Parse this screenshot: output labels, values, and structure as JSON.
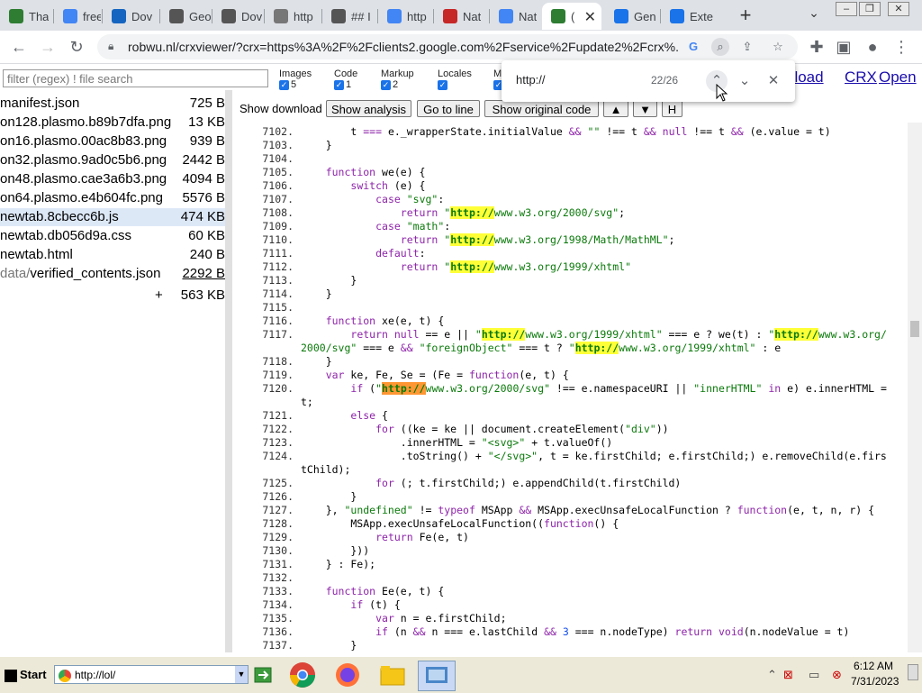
{
  "tabs": [
    {
      "title": "Tha",
      "icon": "plasmo-icon",
      "color": "#2e7d32"
    },
    {
      "title": "free",
      "icon": "google-icon",
      "color": "#4285f4"
    },
    {
      "title": "Dov",
      "icon": "dov-icon",
      "color": "#1565c0"
    },
    {
      "title": "Geo",
      "icon": "geo-icon",
      "color": "#555555"
    },
    {
      "title": "Dov",
      "icon": "globe-icon",
      "color": "#555555"
    },
    {
      "title": "http",
      "icon": "page-icon",
      "color": "#777777"
    },
    {
      "title": "## I",
      "icon": "search-globe-icon",
      "color": "#555555"
    },
    {
      "title": "http",
      "icon": "cloud-icon",
      "color": "#4285f4"
    },
    {
      "title": "Nat",
      "icon": "nat-icon",
      "color": "#c62828"
    },
    {
      "title": "Nat",
      "icon": "cloud-icon",
      "color": "#4285f4"
    },
    {
      "title": "(",
      "icon": "crx-icon",
      "color": "#2e7d32",
      "active": true
    },
    {
      "title": "Gen",
      "icon": "search-icon",
      "color": "#1a73e8"
    },
    {
      "title": "Exte",
      "icon": "puzzle-icon",
      "color": "#1a73e8"
    }
  ],
  "address": {
    "url": "robwu.nl/crxviewer/?crx=https%3A%2F%2Fclients2.google.com%2Fservice%2Fupdate2%2Fcrx%..."
  },
  "filter": {
    "placeholder": "filter (regex) ! file search"
  },
  "file_types": [
    {
      "label": "Images",
      "count": "5"
    },
    {
      "label": "Code",
      "count": "1"
    },
    {
      "label": "Markup",
      "count": "2"
    },
    {
      "label": "Locales",
      "count": ""
    },
    {
      "label": "M",
      "count": ""
    }
  ],
  "files": [
    {
      "name": "manifest.json",
      "size": "725 B"
    },
    {
      "name": "on128.plasmo.b89b7dfa.png",
      "size": "13 KB"
    },
    {
      "name": "on16.plasmo.00ac8b83.png",
      "size": "939 B"
    },
    {
      "name": "on32.plasmo.9ad0c5b6.png",
      "size": "2442 B"
    },
    {
      "name": "on48.plasmo.cae3a6b3.png",
      "size": "4094 B"
    },
    {
      "name": "on64.plasmo.e4b604fc.png",
      "size": "5576 B"
    },
    {
      "name": "newtab.8cbecc6b.js",
      "size": "474 KB",
      "selected": true
    },
    {
      "name": "newtab.db056d9a.css",
      "size": "60 KB"
    },
    {
      "name": "newtab.html",
      "size": "240 B"
    },
    {
      "name_dim": "data/",
      "name": "verified_contents.json",
      "size": "2292 B"
    }
  ],
  "total": {
    "plus": "+",
    "size": "563 KB"
  },
  "buttons": {
    "show_download": "Show download",
    "show_analysis": "Show analysis",
    "go_to_line": "Go to line",
    "show_original": "Show original code",
    "up": "▲",
    "down": "▼",
    "h": "H"
  },
  "top_links": {
    "download": "nload",
    "crx": "CRX",
    "open": "Open"
  },
  "find": {
    "query": "http://",
    "count": "22/26"
  },
  "code_lines": [
    {
      "n": "7102.",
      "html": "        t <span class=\"kw\">===</span> e._wrapperState.initialValue <span class=\"kw\">&amp;&amp;</span> <span class=\"str\">\"\"</span> !== t <span class=\"kw\">&amp;&amp;</span> <span class=\"kw\">null</span> !== t <span class=\"kw\">&amp;&amp;</span> (e.value = t)"
    },
    {
      "n": "7103.",
      "html": "    }"
    },
    {
      "n": "7104.",
      "html": ""
    },
    {
      "n": "7105.",
      "html": "    <span class=\"kw\">function</span> we(e) {"
    },
    {
      "n": "7106.",
      "html": "        <span class=\"kw\">switch</span> (e) {"
    },
    {
      "n": "7107.",
      "html": "            <span class=\"kw\">case</span> <span class=\"str\">\"svg\"</span>:"
    },
    {
      "n": "7108.",
      "html": "                <span class=\"kw\">return</span> <span class=\"str\">\"<span class=\"hl\">http://</span>www.w3.org/2000/svg\"</span>;"
    },
    {
      "n": "7109.",
      "html": "            <span class=\"kw\">case</span> <span class=\"str\">\"math\"</span>:"
    },
    {
      "n": "7110.",
      "html": "                <span class=\"kw\">return</span> <span class=\"str\">\"<span class=\"hl\">http://</span>www.w3.org/1998/Math/MathML\"</span>;"
    },
    {
      "n": "7111.",
      "html": "            <span class=\"kw\">default</span>:"
    },
    {
      "n": "7112.",
      "html": "                <span class=\"kw\">return</span> <span class=\"str\">\"<span class=\"hl\">http://</span>www.w3.org/1999/xhtml\"</span>"
    },
    {
      "n": "7113.",
      "html": "        }"
    },
    {
      "n": "7114.",
      "html": "    }"
    },
    {
      "n": "7115.",
      "html": ""
    },
    {
      "n": "7116.",
      "html": "    <span class=\"kw\">function</span> xe(e, t) {"
    },
    {
      "n": "7117.",
      "html": "        <span class=\"kw\">return</span> <span class=\"kw\">null</span> == e || <span class=\"str\">\"<span class=\"hl\">http://</span>www.w3.org/1999/xhtml\"</span> === e ? we(t) : <span class=\"str\">\"<span class=\"hl\">http://</span>www.w3.org/</span>"
    },
    {
      "n": "",
      "html": "<span class=\"str\">2000/svg\"</span> === e <span class=\"kw\">&amp;&amp;</span> <span class=\"str\">\"foreignObject\"</span> === t ? <span class=\"str\">\"<span class=\"hl\">http://</span>www.w3.org/1999/xhtml\"</span> : e"
    },
    {
      "n": "7118.",
      "html": "    }"
    },
    {
      "n": "7119.",
      "html": "    <span class=\"kw\">var</span> ke, Fe, Se = (Fe = <span class=\"kw\">function</span>(e, t) {"
    },
    {
      "n": "7120.",
      "html": "        <span class=\"kw\">if</span> (<span class=\"str\">\"<span class=\"hlc\">http://</span>www.w3.org/2000/svg\"</span> !== e.namespaceURI || <span class=\"str\">\"innerHTML\"</span> <span class=\"kw\">in</span> e) e.innerHTML ="
    },
    {
      "n": "",
      "html": "t;"
    },
    {
      "n": "7121.",
      "html": "        <span class=\"kw\">else</span> {"
    },
    {
      "n": "7122.",
      "html": "            <span class=\"kw\">for</span> ((ke = ke || document.createElement(<span class=\"str\">\"div\"</span>))"
    },
    {
      "n": "7123.",
      "html": "                .innerHTML = <span class=\"str\">\"&lt;svg&gt;\"</span> + t.valueOf()"
    },
    {
      "n": "7124.",
      "html": "                .toString() + <span class=\"str\">\"&lt;/svg&gt;\"</span>, t = ke.firstChild; e.firstChild;) e.removeChild(e.firs"
    },
    {
      "n": "",
      "html": "tChild);"
    },
    {
      "n": "7125.",
      "html": "            <span class=\"kw\">for</span> (; t.firstChild;) e.appendChild(t.firstChild)"
    },
    {
      "n": "7126.",
      "html": "        }"
    },
    {
      "n": "7127.",
      "html": "    }, <span class=\"str\">\"undefined\"</span> != <span class=\"kw\">typeof</span> MSApp <span class=\"kw\">&amp;&amp;</span> MSApp.execUnsafeLocalFunction ? <span class=\"kw\">function</span>(e, t, n, r) {"
    },
    {
      "n": "7128.",
      "html": "        MSApp.execUnsafeLocalFunction((<span class=\"kw\">function</span>() {"
    },
    {
      "n": "7129.",
      "html": "            <span class=\"kw\">return</span> Fe(e, t)"
    },
    {
      "n": "7130.",
      "html": "        }))"
    },
    {
      "n": "7131.",
      "html": "    } : Fe);"
    },
    {
      "n": "7132.",
      "html": ""
    },
    {
      "n": "7133.",
      "html": "    <span class=\"kw\">function</span> Ee(e, t) {"
    },
    {
      "n": "7134.",
      "html": "        <span class=\"kw\">if</span> (t) {"
    },
    {
      "n": "7135.",
      "html": "            <span class=\"kw\">var</span> n = e.firstChild;"
    },
    {
      "n": "7136.",
      "html": "            <span class=\"kw\">if</span> (n <span class=\"kw\">&amp;&amp;</span> n === e.lastChild <span class=\"kw\">&amp;&amp;</span> <span class=\"num\">3</span> === n.nodeType) <span class=\"kw\">return</span> <span class=\"kw\">void</span>(n.nodeValue = t)"
    },
    {
      "n": "7137.",
      "html": "        }"
    }
  ],
  "taskbar": {
    "start": "Start",
    "address": "http://lol/",
    "time": "6:12 AM",
    "date": "7/31/2023"
  },
  "colors": {
    "highlight": "#ffff38",
    "current_match": "#ff9632",
    "link": "#1a0dab"
  }
}
